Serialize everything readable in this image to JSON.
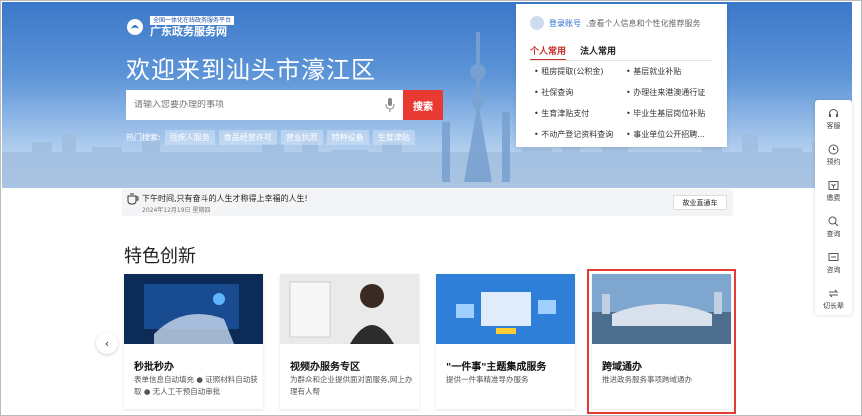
{
  "header": {
    "logo_tagline": "全国一体化在线政务服务平台",
    "logo_name": "广东政务服务网",
    "welcome": "欢迎来到汕头市濠江区"
  },
  "search": {
    "placeholder": "请输入您要办理的事项",
    "button": "搜索",
    "hot_label": "热门搜索:",
    "hot_tags": [
      "残疾人服务",
      "食品经营许可",
      "营业执照",
      "特种设备",
      "生育津贴"
    ]
  },
  "panel": {
    "login_link": "登录账号",
    "login_text": ",查看个人信息和个性化推荐服务",
    "tabs": [
      "个人常用",
      "法人常用"
    ],
    "services": [
      "租房提取(公积金)",
      "基层就业补贴",
      "社保查询",
      "办理往来港澳通行证",
      "生育津贴支付",
      "毕业生基层岗位补贴",
      "不动产登记资料查询",
      "事业单位公开招聘..."
    ]
  },
  "toolbar": {
    "items": [
      {
        "label": "客服",
        "icon": "headset-icon"
      },
      {
        "label": "预约",
        "icon": "clock-icon"
      },
      {
        "label": "缴费",
        "icon": "payment-icon"
      },
      {
        "label": "查询",
        "icon": "search-icon"
      },
      {
        "label": "咨询",
        "icon": "chat-icon"
      },
      {
        "label": "切长辈",
        "icon": "switch-icon"
      }
    ]
  },
  "notice": {
    "main": "下午时间,只有奋斗的人生才称得上幸福的人生!",
    "date": "2024年12月19日 星期四",
    "button": "故业直通车"
  },
  "section": {
    "title": "特色创新",
    "cards": [
      {
        "title": "秒批秒办",
        "desc": "表单信息自动填充 ● 证照材料自动获取 ● 无人工干预自动审批"
      },
      {
        "title": "视频办服务专区",
        "desc": "为群众和企业提供面对面服务,网上办理有人帮"
      },
      {
        "title": "\"一件事\"主题集成服务",
        "desc": "提供一件事精准导办服务"
      },
      {
        "title": "跨域通办",
        "desc": "推进政务服务事项跨域通办"
      }
    ]
  },
  "colors": {
    "brand_blue": "#2a6bd1",
    "search_red": "#e83a33",
    "highlight_red": "#e23b33",
    "tab_red": "#c9302c"
  }
}
